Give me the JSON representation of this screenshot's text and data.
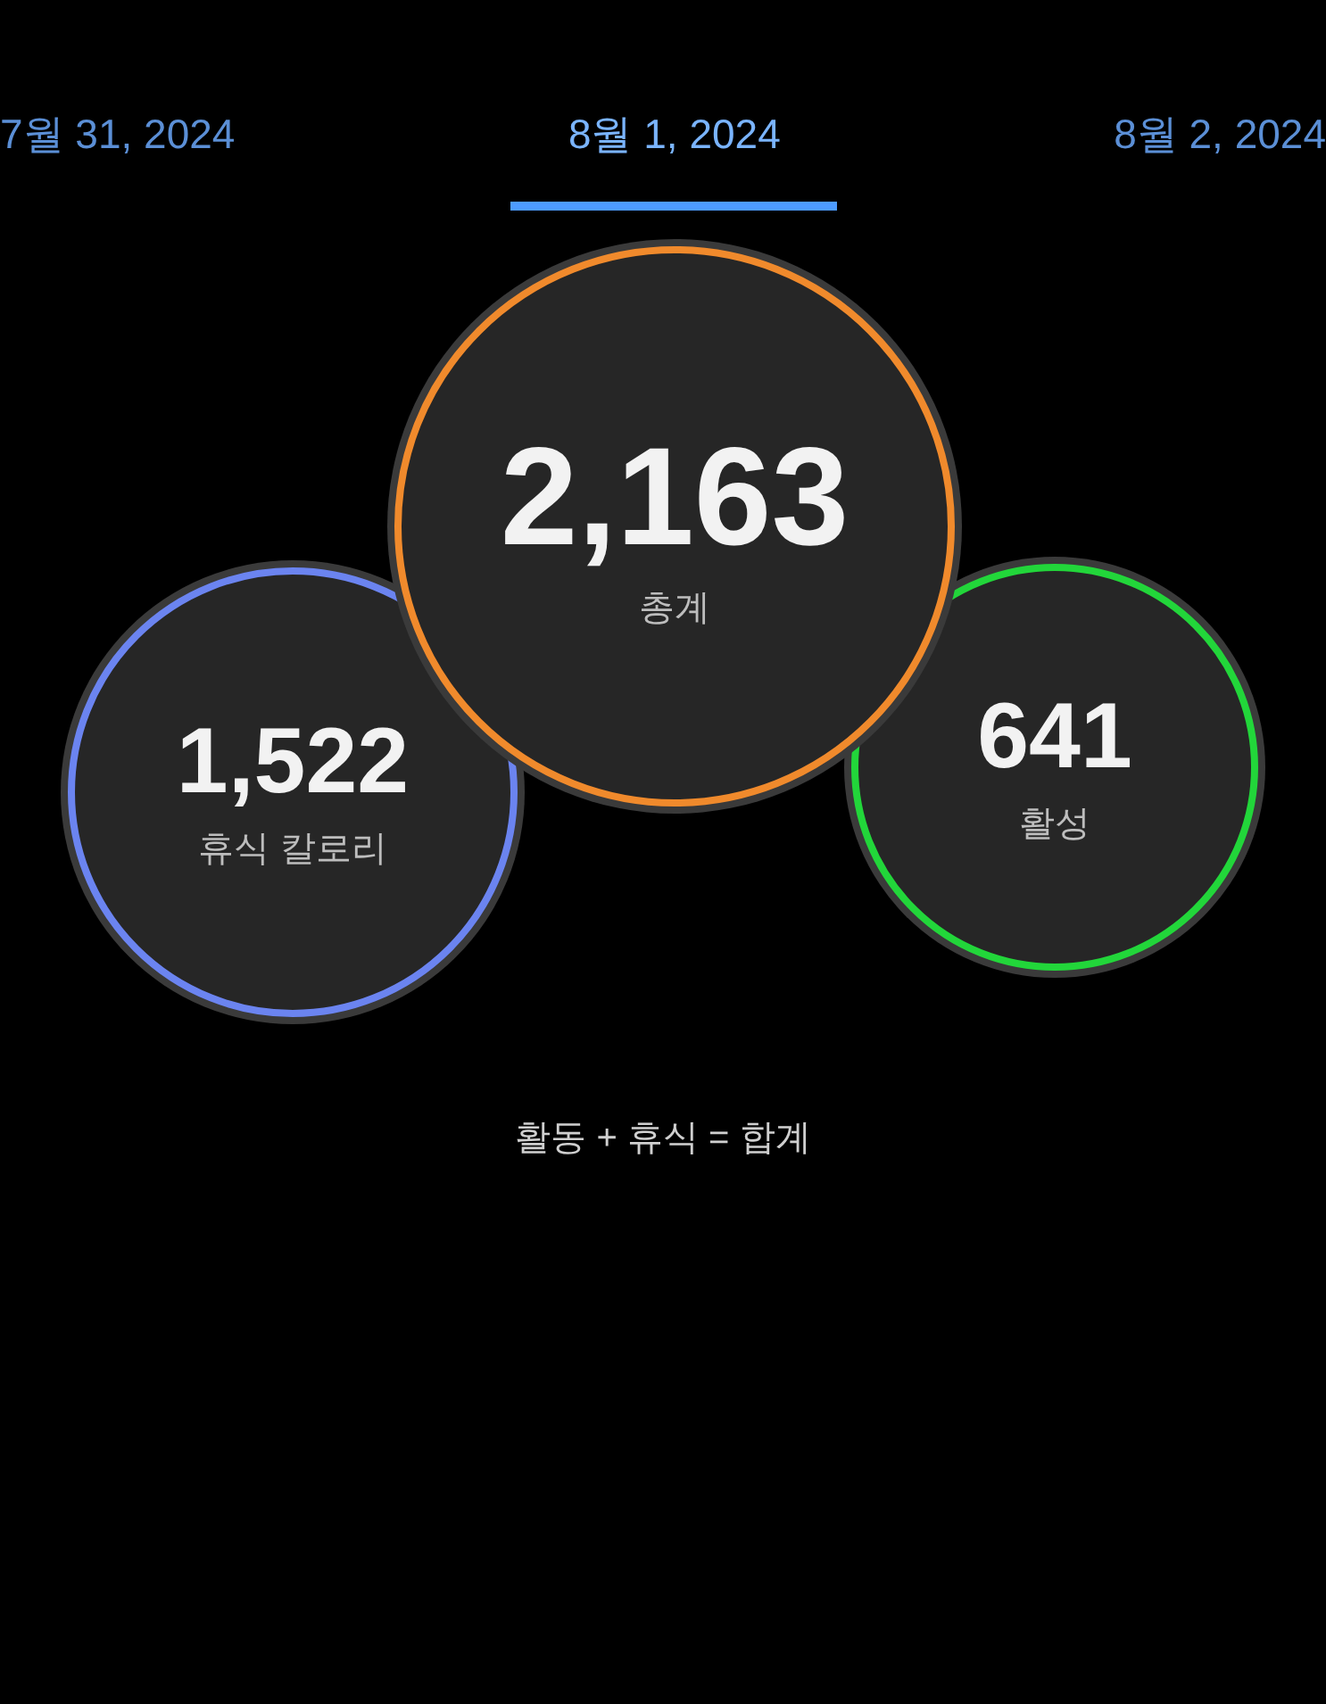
{
  "tabs": [
    {
      "label": "7월 31, 2024",
      "selected": false
    },
    {
      "label": "8월 1, 2024",
      "selected": true
    },
    {
      "label": "8월 2, 2024",
      "selected": false
    }
  ],
  "rings": [
    {
      "kind": "rest",
      "value": "1,522",
      "label": "휴식 칼로리",
      "color": "#6b84f0"
    },
    {
      "kind": "total",
      "value": "2,163",
      "label": "총계",
      "color": "#f08a2c"
    },
    {
      "kind": "active",
      "value": "641",
      "label": "활성",
      "color": "#22d63a"
    }
  ],
  "formula": "활동 + 휴식 = 합계"
}
